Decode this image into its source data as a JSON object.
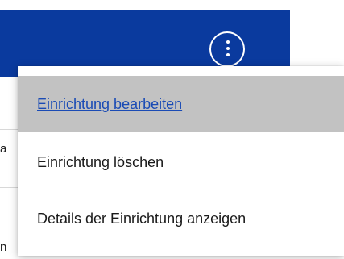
{
  "header": {
    "more_button_icon": "vertical-ellipsis-icon",
    "background_color": "#0a3a9e"
  },
  "background_fragments": {
    "fragment_1": "a",
    "fragment_2": "n"
  },
  "context_menu": {
    "items": [
      {
        "label": "Einrichtung bearbeiten",
        "state": "hovered"
      },
      {
        "label": "Einrichtung löschen",
        "state": "normal"
      },
      {
        "label": "Details der Einrichtung anzeigen",
        "state": "normal"
      }
    ],
    "hover_background": "#c2c2c2",
    "link_color": "#1a4bb5"
  }
}
